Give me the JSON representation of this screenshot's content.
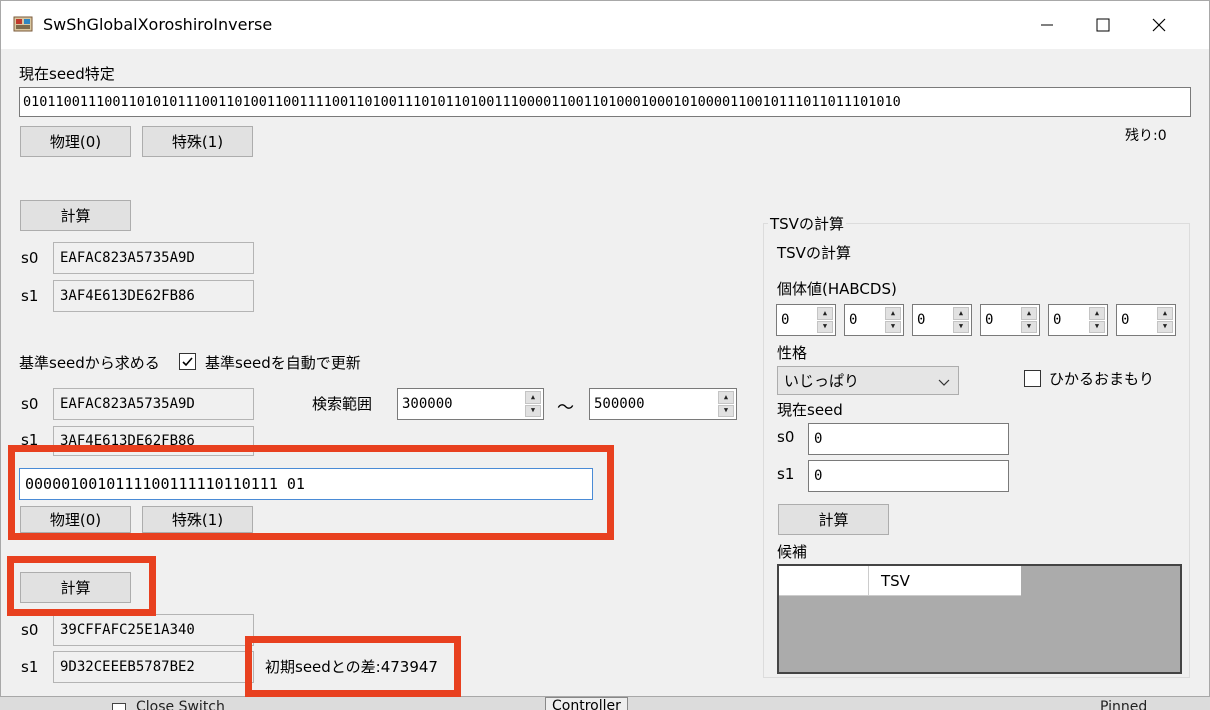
{
  "window": {
    "title": "SwShGlobalXoroshiroInverse",
    "minimize": "—",
    "maximize": "☐",
    "close": "✕"
  },
  "current_seed": {
    "label": "現在seed特定",
    "bits": "010110011100110101011100110100110011110011010011101011010011100001100110100010001010000110010111011011101010",
    "phys_button": "物理(0)",
    "special_button": "特殊(1)",
    "remaining": "残り:0"
  },
  "calc1": {
    "button": "計算",
    "s0_label": "s0",
    "s0_value": "EAFAC823A5735A9D",
    "s1_label": "s1",
    "s1_value": "3AF4E613DE62FB86"
  },
  "base_seed": {
    "label": "基準seedから求める",
    "auto_update_label": "基準seedを自動で更新",
    "auto_update_checked": "☑",
    "s0_label": "s0",
    "s0_value": "EAFAC823A5735A9D",
    "s1_label": "s1",
    "s1_value": "3AF4E613DE62FB86",
    "search_range_label": "検索範囲",
    "range_from": "300000",
    "range_tilde": "〜",
    "range_to": "500000",
    "bits_input": "0000010010111100111110110111 01",
    "phys_button": "物理(0)",
    "special_button": "特殊(1)"
  },
  "calc2": {
    "button": "計算",
    "s0_label": "s0",
    "s0_value": "39CFFAFC25E1A340",
    "s1_label": "s1",
    "s1_value": "9D32CEEEB5787BE2",
    "diff_text": "初期seedとの差:473947"
  },
  "tsv": {
    "group_title": "TSVの計算",
    "inner_title": "TSVの計算",
    "iv_label": "個体値(HABCDS)",
    "ivs": [
      "0",
      "0",
      "0",
      "0",
      "0",
      "0"
    ],
    "nature_label": "性格",
    "nature_value": "いじっぱり",
    "charm_label": "ひかるおまもり",
    "current_seed_label": "現在seed",
    "s0_label": "s0",
    "s0_value": "0",
    "s1_label": "s1",
    "s1_value": "0",
    "calc_button": "計算",
    "candidates_label": "候補",
    "candidates_header": [
      "",
      "TSV"
    ]
  },
  "background": {
    "item1": "Close Switch",
    "item2": "Controller",
    "item3": "Pinned",
    "item4": "Pinned"
  },
  "colors": {
    "highlight": "#e8401f",
    "window_bg": "#f0f0f0"
  }
}
